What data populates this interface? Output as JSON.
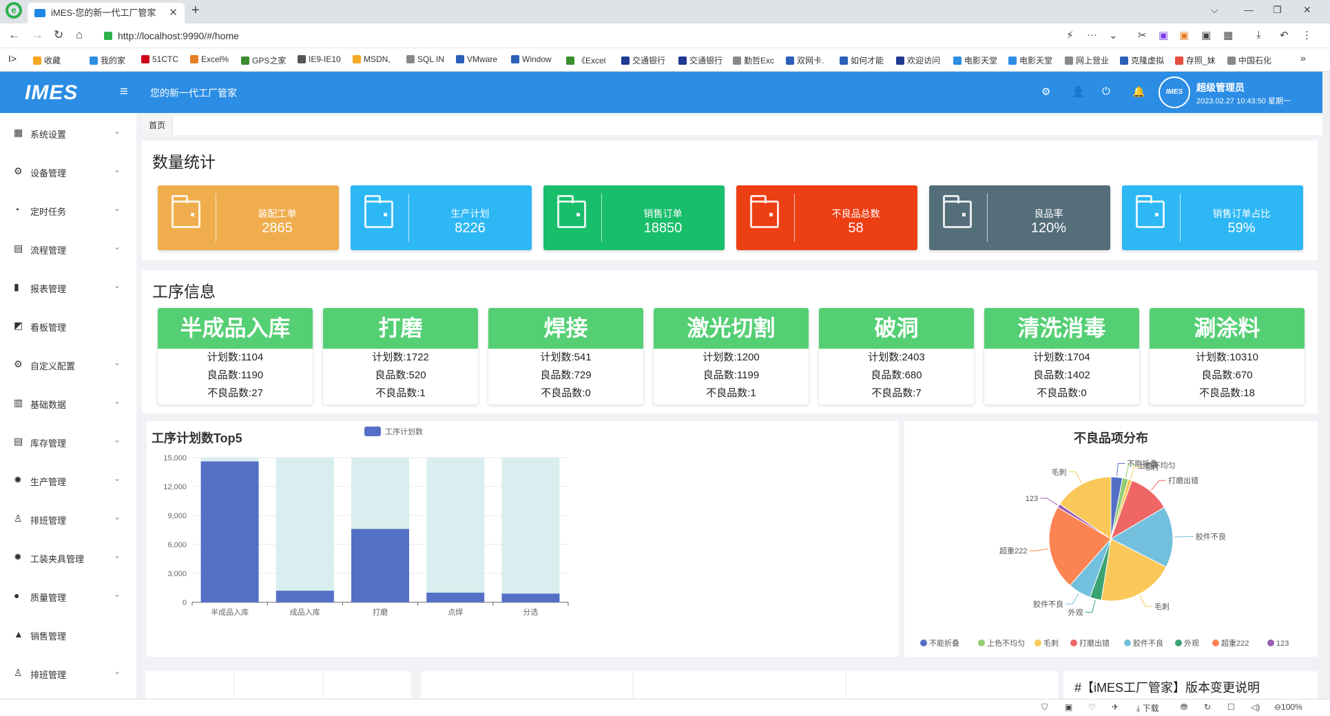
{
  "browser": {
    "logo_letter": "e",
    "tab_title": "iMES-您的新一代工厂管家",
    "tab_close": "✕",
    "new_tab": "+",
    "window_controls": [
      "⌵",
      "—",
      "❐",
      "✕"
    ],
    "url": "http://localhost:9990/#/home",
    "nav": {
      "back": "←",
      "forward": "→",
      "reload": "↻",
      "home": "⌂"
    },
    "addr_right": [
      "⚡",
      "···",
      "⌄",
      "✂",
      "▣",
      "▣",
      "▣",
      "▦",
      "⤓",
      "↶",
      "⋮"
    ],
    "bookmarks": [
      {
        "label": "收藏",
        "color": "#f5a623"
      },
      {
        "label": "我的家",
        "color": "#2b8de4"
      },
      {
        "label": "51CTC",
        "color": "#d0021b"
      },
      {
        "label": "Excel%",
        "color": "#e67e22"
      },
      {
        "label": "GPS之家",
        "color": "#3c8d2f"
      },
      {
        "label": "IE9-IE10",
        "color": "#555555"
      },
      {
        "label": "MSDN,",
        "color": "#f5a623"
      },
      {
        "label": "SQL IN",
        "color": "#888888"
      },
      {
        "label": "VMware",
        "color": "#2b5fb8"
      },
      {
        "label": "Window",
        "color": "#2b5fb8"
      },
      {
        "label": "《Excel",
        "color": "#3c8d2f"
      },
      {
        "label": "交通银行",
        "color": "#1f3a93"
      },
      {
        "label": "交通银行",
        "color": "#1f3a93"
      },
      {
        "label": "勤哲Exc",
        "color": "#888888"
      },
      {
        "label": "双网卡.",
        "color": "#2b5fb8"
      },
      {
        "label": "如何才能",
        "color": "#2b5fb8"
      },
      {
        "label": "欢迎访问",
        "color": "#1f3a93"
      },
      {
        "label": "电影天堂",
        "color": "#2b8de4"
      },
      {
        "label": "电影天堂",
        "color": "#2b8de4"
      },
      {
        "label": "网上营业",
        "color": "#888888"
      },
      {
        "label": "克隆虚拟",
        "color": "#2b5fb8"
      },
      {
        "label": "存照_妹",
        "color": "#e74c3c"
      },
      {
        "label": "中国石化",
        "color": "#888888"
      }
    ],
    "bookmarks_more": "»",
    "status_bar": [
      "⛉",
      "▣",
      "♡",
      "✈",
      "⤓ 下载",
      "⛃",
      "↻",
      "☐",
      "◁)",
      "⊖100%"
    ]
  },
  "app": {
    "logo": "IMES",
    "menu_icon": "≡",
    "slogan": "您的新一代工厂管家",
    "header_icons": [
      "⚙",
      "👤",
      "⏻",
      "🔔"
    ],
    "avatar_text": "IMES",
    "username": "超级管理员",
    "datetime": "2023.02.27 10:43:50 星期一"
  },
  "sidebar": {
    "chevron": "⌄",
    "items": [
      {
        "label": "系统设置",
        "icon": "▦",
        "icon_name": "grid-icon",
        "has_chevron": true
      },
      {
        "label": "设备管理",
        "icon": "⚙",
        "icon_name": "gear-icon",
        "has_chevron": true
      },
      {
        "label": "定时任务",
        "icon": "◔",
        "icon_name": "clock-icon",
        "has_chevron": true
      },
      {
        "label": "流程管理",
        "icon": "▤",
        "icon_name": "flow-icon",
        "has_chevron": true
      },
      {
        "label": "报表管理",
        "icon": "▮",
        "icon_name": "bar-chart-icon",
        "has_chevron": true
      },
      {
        "label": "看板管理",
        "icon": "◩",
        "icon_name": "line-chart-icon",
        "has_chevron": false
      },
      {
        "label": "自定义配置",
        "icon": "⚙",
        "icon_name": "settings-icon",
        "has_chevron": true
      },
      {
        "label": "基础数据",
        "icon": "▥",
        "icon_name": "document-icon",
        "has_chevron": true
      },
      {
        "label": "库存管理",
        "icon": "▤",
        "icon_name": "inventory-icon",
        "has_chevron": true
      },
      {
        "label": "生产管理",
        "icon": "✹",
        "icon_name": "cog-icon",
        "has_chevron": true
      },
      {
        "label": "排班管理",
        "icon": "♙",
        "icon_name": "user-icon",
        "has_chevron": true
      },
      {
        "label": "工装夹具管理",
        "icon": "✹",
        "icon_name": "fixture-icon",
        "has_chevron": true
      },
      {
        "label": "质量管理",
        "icon": "●",
        "icon_name": "alert-icon",
        "has_chevron": true
      },
      {
        "label": "销售管理",
        "icon": "▲",
        "icon_name": "bag-icon",
        "has_chevron": false
      },
      {
        "label": "排班管理",
        "icon": "♙",
        "icon_name": "user-icon",
        "has_chevron": true
      }
    ]
  },
  "breadcrumb": "首页",
  "stats": {
    "title": "数量统计",
    "cards": [
      {
        "label": "装配工单",
        "value": "2865",
        "color": "#f0ad4e"
      },
      {
        "label": "生产计划",
        "value": "8226",
        "color": "#2db7f5"
      },
      {
        "label": "销售订单",
        "value": "18850",
        "color": "#19be6b"
      },
      {
        "label": "不良品总数",
        "value": "58",
        "color": "#ed3f14"
      },
      {
        "label": "良品率",
        "value": "120%",
        "color": "#546e7a"
      },
      {
        "label": "销售订单占比",
        "value": "59%",
        "color": "#2db7f5"
      }
    ]
  },
  "process": {
    "title": "工序信息",
    "items": [
      {
        "name": "半成品入库",
        "plan": "计划数:1104",
        "good": "良品数:1190",
        "bad": "不良品数:27"
      },
      {
        "name": "打磨",
        "plan": "计划数:1722",
        "good": "良品数:520",
        "bad": "不良品数:1"
      },
      {
        "name": "焊接",
        "plan": "计划数:541",
        "good": "良品数:729",
        "bad": "不良品数:0"
      },
      {
        "name": "激光切割",
        "plan": "计划数:1200",
        "good": "良品数:1199",
        "bad": "不良品数:1"
      },
      {
        "name": "破洞",
        "plan": "计划数:2403",
        "good": "良品数:680",
        "bad": "不良品数:7"
      },
      {
        "name": "清洗消毒",
        "plan": "计划数:1704",
        "good": "良品数:1402",
        "bad": "不良品数:0"
      },
      {
        "name": "涮涂料",
        "plan": "计划数:10310",
        "good": "良品数:670",
        "bad": "不良品数:18"
      }
    ]
  },
  "changelog_title": "#【iMES工厂管家】版本变更说明",
  "chart_data": [
    {
      "type": "bar",
      "title": "工序计划数Top5",
      "legend": [
        "工序计划数"
      ],
      "legend_position": "top-center",
      "categories": [
        "半成品入库",
        "成品入库",
        "打磨",
        "点焊",
        "分选"
      ],
      "series": [
        {
          "name": "工序计划数",
          "values": [
            14600,
            1200,
            7600,
            1000,
            900
          ],
          "color": "#5470c6"
        }
      ],
      "background_bar_value": 15000,
      "background_bar_color": "#d9eeee",
      "ylim": [
        0,
        15000
      ],
      "yticks": [
        0,
        3000,
        6000,
        9000,
        12000,
        15000
      ],
      "ytick_labels": [
        "0",
        "3,000",
        "6,000",
        "9,000",
        "12,000",
        "15,000"
      ],
      "xlabel": "",
      "ylabel": "",
      "grid": true
    },
    {
      "type": "pie",
      "title": "不良品项分布",
      "legend_position": "bottom",
      "labels": [
        "不能折叠",
        "上色不均匀",
        "毛刺",
        "打磨出错",
        "胶件不良",
        "毛刺",
        "外观",
        "胶件不良",
        "超重222",
        "123",
        "毛刺"
      ],
      "values": [
        3,
        1.5,
        1,
        11,
        16,
        20,
        3,
        6,
        22,
        1,
        15.5
      ],
      "colors": [
        "#5470c6",
        "#91cc75",
        "#fac858",
        "#ee6666",
        "#73c0de",
        "#fac858",
        "#3ba272",
        "#73c0de",
        "#fc8452",
        "#9a60b4",
        "#fac858"
      ],
      "legend": [
        {
          "name": "不能折叠",
          "color": "#5470c6"
        },
        {
          "name": "上色不均匀",
          "color": "#91cc75"
        },
        {
          "name": "毛刺",
          "color": "#fac858"
        },
        {
          "name": "打磨出错",
          "color": "#ee6666"
        },
        {
          "name": "胶件不良",
          "color": "#73c0de"
        },
        {
          "name": "外观",
          "color": "#3ba272"
        },
        {
          "name": "超重222",
          "color": "#fc8452"
        },
        {
          "name": "123",
          "color": "#9a60b4"
        }
      ]
    }
  ]
}
